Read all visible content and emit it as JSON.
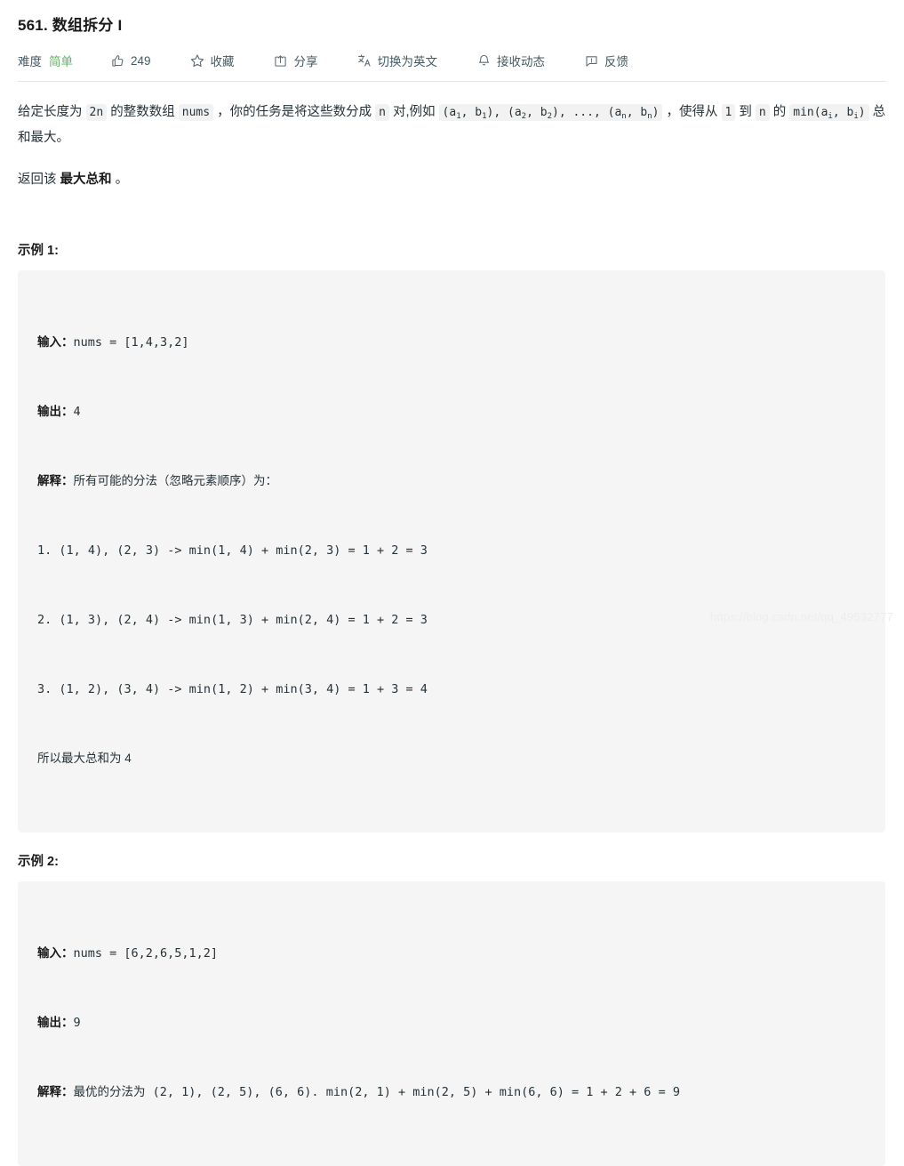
{
  "problem": {
    "title": "561. 数组拆分 I",
    "difficulty_label": "难度",
    "difficulty_value": "简单",
    "difficulty_color": "#5cb85c"
  },
  "toolbar": {
    "like_count": "249",
    "favorite_label": "收藏",
    "share_label": "分享",
    "translate_label": "切换为英文",
    "subscribe_label": "接收动态",
    "feedback_label": "反馈",
    "icons": {
      "like": "thumbs-up-icon",
      "favorite": "star-icon",
      "share": "share-icon",
      "translate": "translate-icon",
      "subscribe": "bell-icon",
      "feedback": "comment-icon"
    }
  },
  "description": {
    "p1_seg1": "给定长度为",
    "p1_code1": "2n",
    "p1_seg2": "的整数数组",
    "p1_code2": "nums",
    "p1_seg3": "，你的任务是将这些数分成",
    "p1_code3": "n",
    "p1_seg4": "对,",
    "p1_seg5": "例如",
    "p1_code4_a1": "a",
    "p1_code4_sub1": "1",
    "p1_code4_b1": "b",
    "p1_code4": "(a1, b1), (a2, b2), ..., (an, bn)",
    "p1_seg6": "，使得从",
    "p1_code5": "1",
    "p1_seg7": "到",
    "p1_code6": "n",
    "p1_seg8": "的",
    "p1_code7": "min(ai, bi)",
    "p1_seg9": "总和最大。",
    "p2_seg1": "返回该",
    "p2_bold": "最大总和",
    "p2_seg2": "。"
  },
  "examples": [
    {
      "heading": "示例 1:",
      "input_label": "输入：",
      "input_value": "nums = [1,4,3,2]",
      "output_label": "输出：",
      "output_value": "4",
      "explain_label": "解释：",
      "explain_value": "所有可能的分法（忽略元素顺序）为：",
      "lines": [
        "1. (1, 4), (2, 3) -> min(1, 4) + min(2, 3) = 1 + 2 = 3",
        "2. (1, 3), (2, 4) -> min(1, 3) + min(2, 4) = 1 + 2 = 3",
        "3. (1, 2), (3, 4) -> min(1, 2) + min(3, 4) = 1 + 3 = 4"
      ],
      "footer": "所以最大总和为 4"
    },
    {
      "heading": "示例 2:",
      "input_label": "输入：",
      "input_value": "nums = [6,2,6,5,1,2]",
      "output_label": "输出：",
      "output_value": "9",
      "explain_label": "解释：",
      "explain_value": "最优的分法为 (2, 1), (2, 5), (6, 6). min(2, 1) + min(2, 5) + min(6, 6) = 1 + 2 + 6 = 9",
      "lines": [],
      "footer": ""
    }
  ],
  "watermark": "https://blog.csdn.net/qq_49532777"
}
